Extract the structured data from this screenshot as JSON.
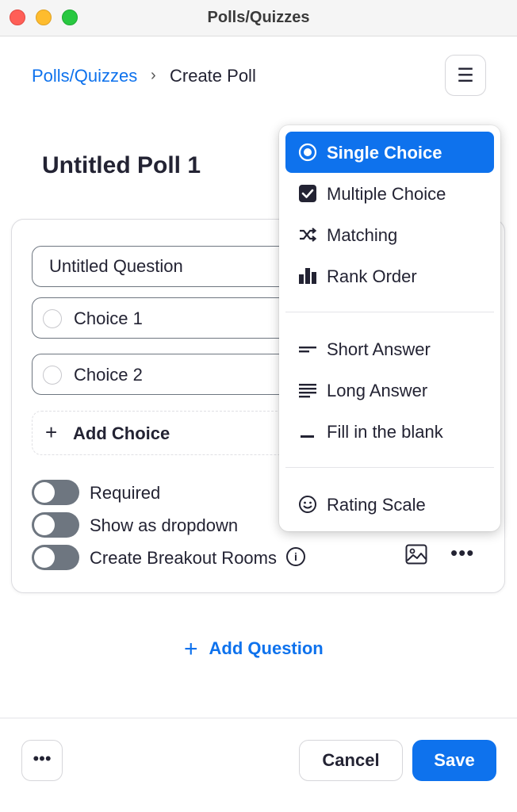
{
  "window": {
    "title": "Polls/Quizzes"
  },
  "breadcrumb": {
    "parent": "Polls/Quizzes",
    "separator": "›",
    "current": "Create Poll"
  },
  "header": {
    "menu_icon": "☰"
  },
  "poll": {
    "title": "Untitled Poll 1"
  },
  "question": {
    "title": "Untitled Question",
    "choices": [
      "Choice 1",
      "Choice 2"
    ],
    "add_choice_label": "Add Choice",
    "add_choice_icon": "+",
    "toggles": [
      {
        "label": "Required",
        "on": false
      },
      {
        "label": "Show as dropdown",
        "on": false
      },
      {
        "label": "Create Breakout Rooms",
        "on": false
      }
    ],
    "info_icon": "i",
    "more_icon": "•••"
  },
  "add_question": {
    "icon": "+",
    "label": "Add Question"
  },
  "footer": {
    "more_icon": "•••",
    "cancel_label": "Cancel",
    "save_label": "Save"
  },
  "question_type_menu": {
    "items": [
      {
        "label": "Single Choice",
        "icon": "radio-selected-icon",
        "selected": true
      },
      {
        "label": "Multiple Choice",
        "icon": "checkbox-icon",
        "selected": false
      },
      {
        "label": "Matching",
        "icon": "shuffle-icon",
        "selected": false
      },
      {
        "label": "Rank Order",
        "icon": "bar-chart-icon",
        "selected": false
      },
      {
        "label": "Short Answer",
        "icon": "short-lines-icon",
        "selected": false
      },
      {
        "label": "Long Answer",
        "icon": "long-lines-icon",
        "selected": false
      },
      {
        "label": "Fill in the blank",
        "icon": "blank-line-icon",
        "selected": false
      },
      {
        "label": "Rating Scale",
        "icon": "smiley-icon",
        "selected": false
      }
    ]
  },
  "colors": {
    "accent": "#0e72ed",
    "toggle_off": "#6e7680",
    "text": "#232333"
  }
}
